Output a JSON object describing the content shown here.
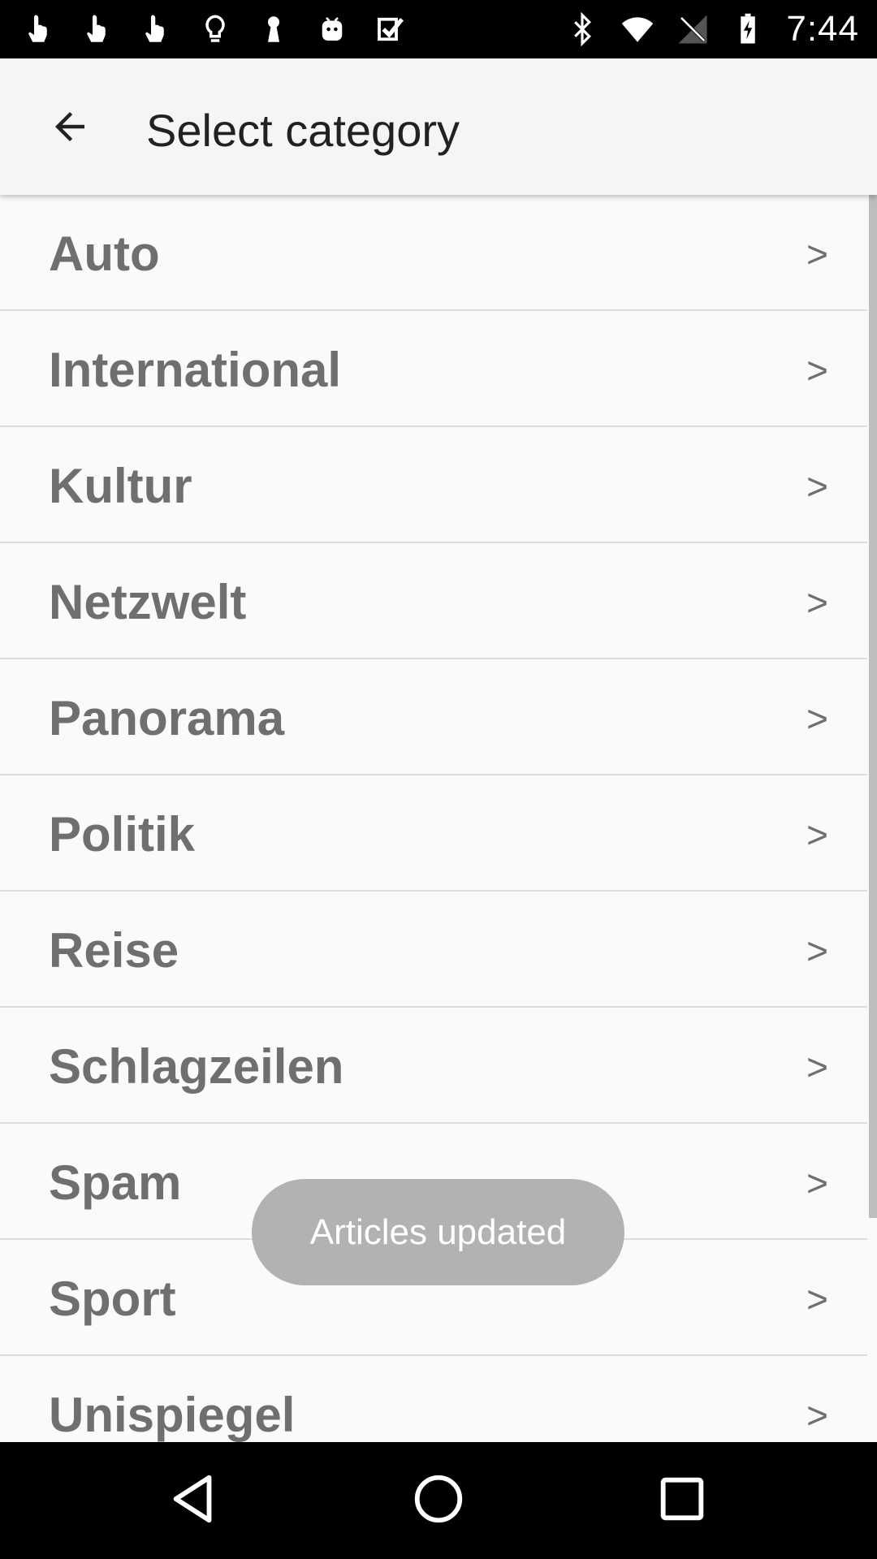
{
  "status_bar": {
    "left_icons": [
      "touch-icon",
      "touch-icon",
      "touch-icon",
      "lightbulb-icon",
      "keyhole-icon",
      "android-icon",
      "checkbox-icon"
    ],
    "right_icons": [
      "bluetooth-icon",
      "wifi-icon",
      "no-signal-icon",
      "battery-charging-icon"
    ],
    "time": "7:44"
  },
  "app_bar": {
    "title": "Select category",
    "back_icon": "arrow-back-icon"
  },
  "categories": [
    {
      "label": "Auto",
      "chevron": ">"
    },
    {
      "label": "International",
      "chevron": ">"
    },
    {
      "label": "Kultur",
      "chevron": ">"
    },
    {
      "label": "Netzwelt",
      "chevron": ">"
    },
    {
      "label": "Panorama",
      "chevron": ">"
    },
    {
      "label": "Politik",
      "chevron": ">"
    },
    {
      "label": "Reise",
      "chevron": ">"
    },
    {
      "label": "Schlagzeilen",
      "chevron": ">"
    },
    {
      "label": "Spam",
      "chevron": ">"
    },
    {
      "label": "Sport",
      "chevron": ">"
    },
    {
      "label": "Unispiegel",
      "chevron": ">"
    }
  ],
  "toast": {
    "text": "Articles updated"
  },
  "nav_bar": {
    "icons": [
      "back-triangle-icon",
      "home-circle-icon",
      "recents-square-icon"
    ]
  },
  "colors": {
    "app_bar_bg": "#f5f5f5",
    "list_bg": "#fafafa",
    "list_text": "#6f6f6f",
    "divider": "#dcdcdc",
    "toast_bg": "#b2b2b2"
  }
}
